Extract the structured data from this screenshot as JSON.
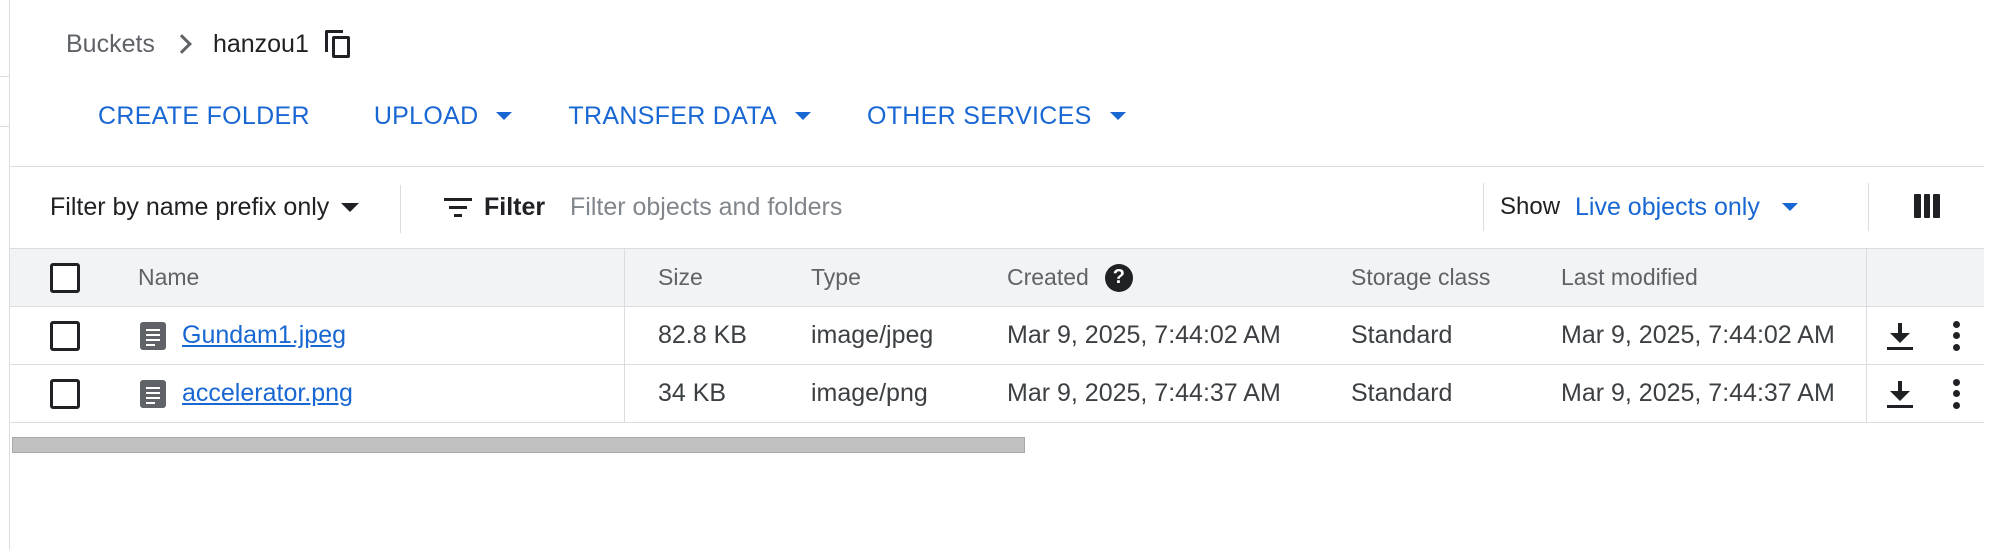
{
  "breadcrumb": {
    "parent": "Buckets",
    "current": "hanzou1",
    "copy_icon": "copy-icon"
  },
  "toolbar": {
    "create_folder": "CREATE FOLDER",
    "upload": "UPLOAD",
    "transfer_data": "TRANSFER DATA",
    "other_services": "OTHER SERVICES"
  },
  "filterbar": {
    "prefix_mode": "Filter by name prefix only",
    "filter_label": "Filter",
    "filter_placeholder": "Filter objects and folders",
    "show_label": "Show",
    "show_value": "Live objects only"
  },
  "table": {
    "headers": {
      "name": "Name",
      "size": "Size",
      "type": "Type",
      "created": "Created",
      "storage_class": "Storage class",
      "last_modified": "Last modified"
    },
    "rows": [
      {
        "name": "Gundam1.jpeg",
        "size": "82.8 KB",
        "type": "image/jpeg",
        "created": "Mar 9, 2025, 7:44:02 AM",
        "storage_class": "Standard",
        "last_modified": "Mar 9, 2025, 7:44:02 AM"
      },
      {
        "name": "accelerator.png",
        "size": "34 KB",
        "type": "image/png",
        "created": "Mar 9, 2025, 7:44:37 AM",
        "storage_class": "Standard",
        "last_modified": "Mar 9, 2025, 7:44:37 AM"
      }
    ]
  },
  "colors": {
    "accent": "#1967d2",
    "text": "#202124",
    "muted": "#5f6368",
    "header_bg": "#f1f3f4",
    "border": "#dadce0"
  }
}
